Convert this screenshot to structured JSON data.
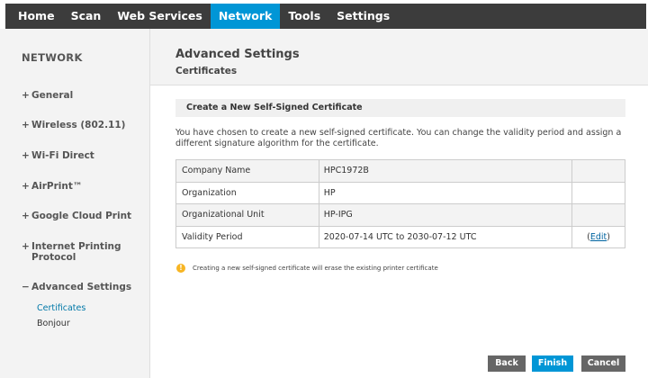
{
  "nav": {
    "tabs": [
      {
        "label": "Home"
      },
      {
        "label": "Scan"
      },
      {
        "label": "Web Services"
      },
      {
        "label": "Network"
      },
      {
        "label": "Tools"
      },
      {
        "label": "Settings"
      }
    ],
    "active": "Network"
  },
  "sidebar": {
    "title": "NETWORK",
    "items": [
      {
        "prefix": "+",
        "label": "General"
      },
      {
        "prefix": "+",
        "label": "Wireless (802.11)"
      },
      {
        "prefix": "+",
        "label": "Wi-Fi Direct"
      },
      {
        "prefix": "+",
        "label": "AirPrint™"
      },
      {
        "prefix": "+",
        "label": "Google Cloud Print"
      },
      {
        "prefix": "+",
        "label_line1": "Internet Printing",
        "label_line2": "Protocol"
      },
      {
        "prefix": "−",
        "label": "Advanced Settings"
      }
    ],
    "subitems": [
      {
        "label": "Certificates",
        "active": true
      },
      {
        "label": "Bonjour",
        "active": false
      }
    ]
  },
  "header": {
    "title": "Advanced Settings",
    "subtitle": "Certificates"
  },
  "section": {
    "title": "Create a New Self-Signed Certificate",
    "description": "You have chosen to create a new self-signed certificate. You can change the validity period and assign a different signature algorithm for the certificate."
  },
  "table": {
    "rows": [
      {
        "label": "Company Name",
        "value": "HPC1972B",
        "action": ""
      },
      {
        "label": "Organization",
        "value": "HP",
        "action": ""
      },
      {
        "label": "Organizational Unit",
        "value": "HP-IPG",
        "action": ""
      },
      {
        "label": "Validity Period",
        "value": "2020-07-14 UTC to 2030-07-12 UTC",
        "action_open": "(",
        "action": "Edit",
        "action_close": ")"
      }
    ]
  },
  "warning": {
    "icon": "!",
    "text": "Creating a new self-signed certificate will erase the existing printer certificate"
  },
  "buttons": {
    "back": "Back",
    "finish": "Finish",
    "cancel": "Cancel"
  },
  "colors": {
    "accent": "#0096d6",
    "nav_bg": "#3c3c3c",
    "warning": "#f7b523",
    "button_gray": "#666666"
  }
}
